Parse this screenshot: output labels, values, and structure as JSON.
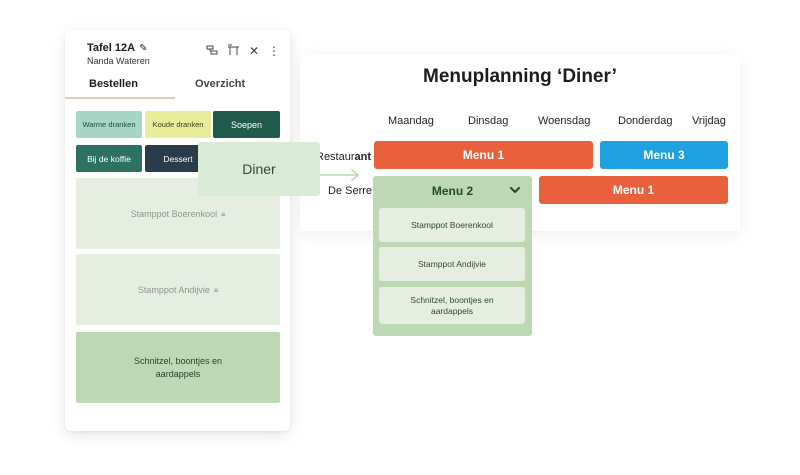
{
  "pos": {
    "table_title": "Tafel 12A",
    "guest_name": "Nanda Wateren",
    "tabs": [
      {
        "label": "Bestellen",
        "active": true
      },
      {
        "label": "Overzicht",
        "active": false
      }
    ],
    "categories": [
      {
        "label": "Warme dranken",
        "bg": "#a7d6c9",
        "fg": "#1f4a3a"
      },
      {
        "label": "Koude dranken",
        "bg": "#e9ec9b",
        "fg": "#3f4016"
      },
      {
        "label": "Soepen",
        "bg": "#1f5a4c",
        "fg": "#ffffff"
      },
      {
        "label": "Bij de koffie",
        "bg": "#2d7163",
        "fg": "#ffffff"
      },
      {
        "label": "Dessert",
        "bg": "#2a3b4b",
        "fg": "#ffffff"
      }
    ],
    "products": [
      {
        "label": "Stamppot Boerenkool",
        "state": "unavailable"
      },
      {
        "label": "Stamppot Andijvie",
        "state": "unavailable"
      },
      {
        "label": "Schnitzel, boontjes en aardappels",
        "state": "available"
      }
    ]
  },
  "overlay": {
    "label": "Diner"
  },
  "planning": {
    "title": "Menuplanning ‘Diner’",
    "days": [
      "Maandag",
      "Dinsdag",
      "Woensdag",
      "Donderdag",
      "Vrijdag"
    ],
    "rows": [
      {
        "label_prefix": "Restaur",
        "label_bold": "ant"
      },
      {
        "label": "De Serre"
      }
    ],
    "bars": [
      {
        "label": "Menu 1",
        "color": "#e8603c"
      },
      {
        "label": "Menu 3",
        "color": "#1fa0e0"
      },
      {
        "label": "Menu 1",
        "color": "#e8603c"
      }
    ],
    "dropdown": {
      "selected": "Menu 2",
      "items": [
        "Stamppot Boerenkool",
        "Stamppot Andijvie",
        "Schnitzel, boontjes en aardappels"
      ]
    }
  },
  "colors": {
    "accent_green": "#bcd9b3",
    "menu_orange": "#e8603c",
    "menu_blue": "#1fa0e0"
  }
}
